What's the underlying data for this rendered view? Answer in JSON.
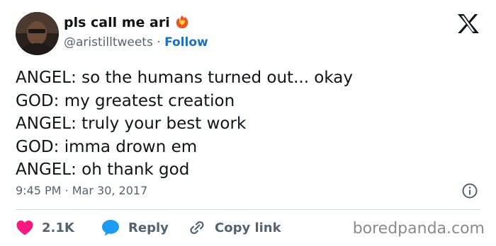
{
  "author": {
    "display_name": "pls call me ari",
    "handle": "@aristilltweets",
    "separator": "·",
    "follow_label": "Follow"
  },
  "tweet": {
    "lines": [
      "ANGEL: so the humans turned out... okay",
      "GOD: my greatest creation",
      "ANGEL: truly your best work",
      "GOD: imma drown em",
      "ANGEL: oh thank god"
    ],
    "time": "9:45 PM",
    "date_separator": "·",
    "date": "Mar 30, 2017"
  },
  "actions": {
    "like_count": "2.1K",
    "reply_label": "Reply",
    "copy_link_label": "Copy link"
  },
  "watermark": "boredpanda.com",
  "colors": {
    "like": "#f91880",
    "reply": "#1d9bf0",
    "follow": "#1d6fc4",
    "muted": "#536471"
  },
  "icons": [
    "heart-fire-badge-icon",
    "x-logo-icon",
    "info-icon",
    "heart-icon",
    "speech-bubble-icon",
    "link-icon"
  ]
}
